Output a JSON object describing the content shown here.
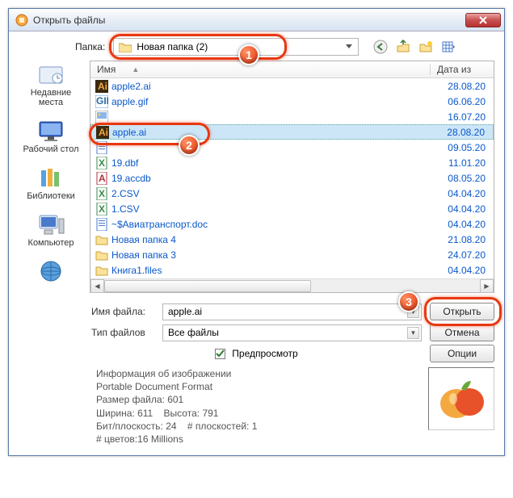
{
  "title": "Открыть файлы",
  "folder_label": "Папка:",
  "folder_value": "Новая папка (2)",
  "columns": {
    "name": "Имя",
    "date": "Дата из"
  },
  "places": [
    {
      "label": "Недавние места",
      "icon": "recent"
    },
    {
      "label": "Рабочий стол",
      "icon": "desktop"
    },
    {
      "label": "Библиотеки",
      "icon": "libraries"
    },
    {
      "label": "Компьютер",
      "icon": "computer"
    },
    {
      "label": "",
      "icon": "network"
    }
  ],
  "files": [
    {
      "name": "apple2.ai",
      "date": "28.08.20",
      "icon": "ai"
    },
    {
      "name": "apple.gif",
      "date": "06.06.20",
      "icon": "gif"
    },
    {
      "name": "",
      "date": "16.07.20",
      "icon": "img"
    },
    {
      "name": "apple.ai",
      "date": "28.08.20",
      "icon": "ai",
      "selected": true
    },
    {
      "name": "",
      "date": "09.05.20",
      "icon": "doc"
    },
    {
      "name": "19.dbf",
      "date": "11.01.20",
      "icon": "xls"
    },
    {
      "name": "19.accdb",
      "date": "08.05.20",
      "icon": "acc"
    },
    {
      "name": "2.CSV",
      "date": "04.04.20",
      "icon": "xls"
    },
    {
      "name": "1.CSV",
      "date": "04.04.20",
      "icon": "xls"
    },
    {
      "name": "~$Авиатранспорт.doc",
      "date": "04.04.20",
      "icon": "doc"
    },
    {
      "name": "Новая папка 4",
      "date": "21.08.20",
      "icon": "folder"
    },
    {
      "name": "Новая папка 3",
      "date": "24.07.20",
      "icon": "folder"
    },
    {
      "name": "Книга1.files",
      "date": "04.04.20",
      "icon": "folder"
    }
  ],
  "filename_label": "Имя файла:",
  "filename_value": "apple.ai",
  "filetype_label": "Тип файлов",
  "filetype_value": "Все файлы",
  "buttons": {
    "open": "Открыть",
    "cancel": "Отмена",
    "options": "Опции"
  },
  "preview_label": "Предпросмотр",
  "info": {
    "heading": "Информация об изображении",
    "format": "Portable Document Format",
    "size_label": "Размер файла:",
    "size": "601",
    "width_label": "Ширина:",
    "width": "611",
    "height_label": "Высота:",
    "height": "791",
    "bpp_label": "Бит/плоскость:",
    "bpp": "24",
    "planes_label": "# плоскостей:",
    "planes": "1",
    "colors_label": "# цветов:",
    "colors": "16 Millions"
  },
  "callouts": {
    "c1": "1",
    "c2": "2",
    "c3": "3"
  }
}
